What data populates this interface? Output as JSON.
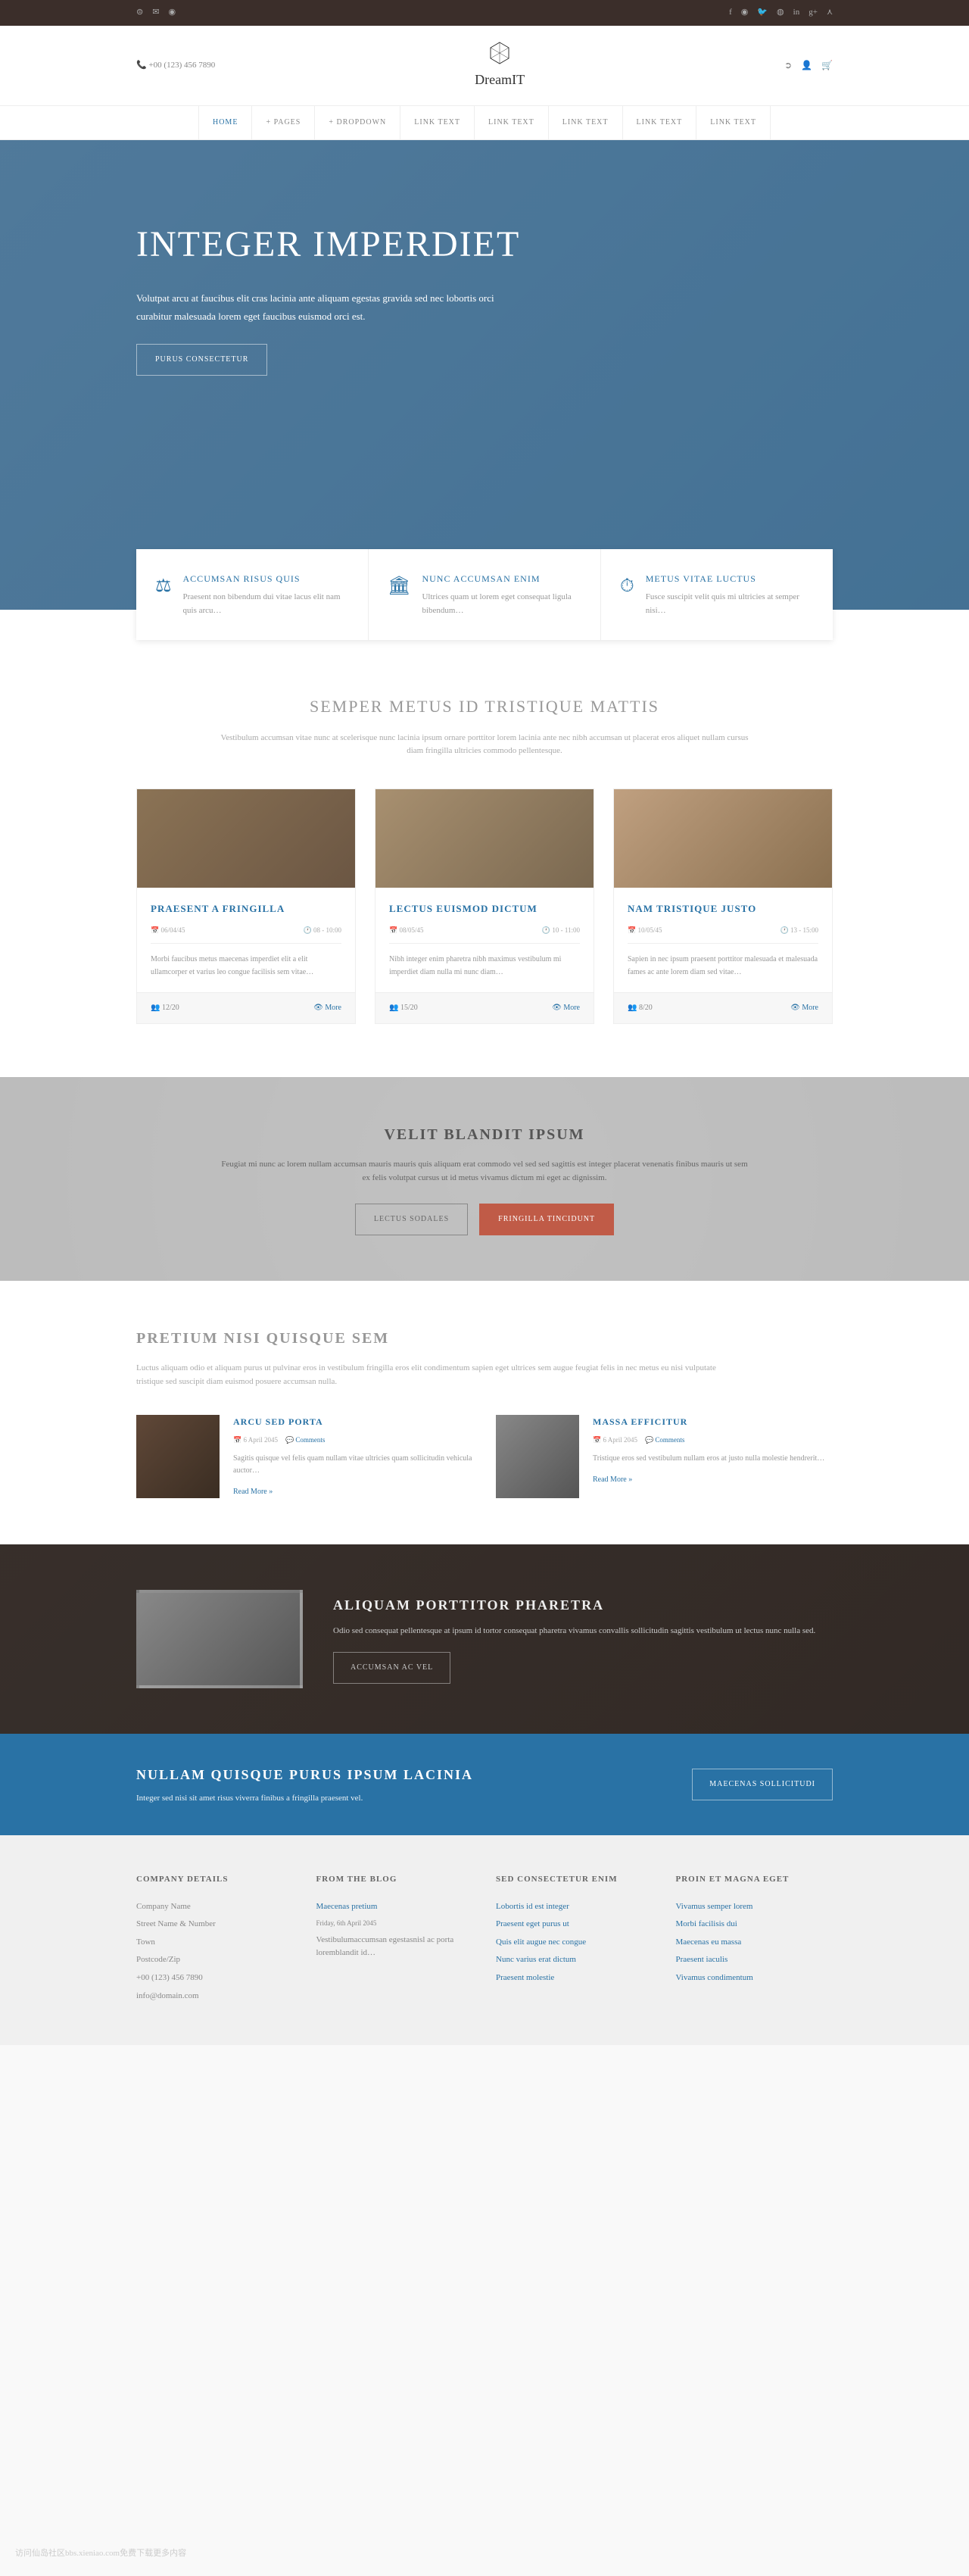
{
  "topbar": {
    "left_icons": [
      "skype",
      "mail",
      "globe"
    ],
    "right_icons": [
      "facebook",
      "pinterest",
      "twitter",
      "dribbble",
      "linkedin",
      "google-plus",
      "rss"
    ]
  },
  "header": {
    "phone": "+00 (123) 456 7890",
    "logo": "DreamIT",
    "icons": [
      "login",
      "user",
      "cart"
    ]
  },
  "nav": [
    {
      "label": "HOME",
      "active": true
    },
    {
      "label": "+ PAGES"
    },
    {
      "label": "+ DROPDOWN"
    },
    {
      "label": "LINK TEXT"
    },
    {
      "label": "LINK TEXT"
    },
    {
      "label": "LINK TEXT"
    },
    {
      "label": "LINK TEXT"
    },
    {
      "label": "LINK TEXT"
    }
  ],
  "hero": {
    "title": "INTEGER IMPERDIET",
    "text": "Volutpat arcu at faucibus elit cras lacinia ante aliquam egestas gravida sed nec lobortis orci curabitur malesuada lorem eget faucibus euismod orci est.",
    "button": "PURUS CONSECTETUR"
  },
  "intro": [
    {
      "icon": "gavel",
      "title": "ACCUMSAN RISUS QUIS",
      "text": "Praesent non bibendum dui vitae lacus elit nam quis arcu…"
    },
    {
      "icon": "columns",
      "title": "NUNC ACCUMSAN ENIM",
      "text": "Ultrices quam ut lorem eget consequat ligula bibendum…"
    },
    {
      "icon": "clock",
      "title": "METUS VITAE LUCTUS",
      "text": "Fusce suscipit velit quis mi ultricies at semper nisi…"
    }
  ],
  "section1": {
    "title": "SEMPER METUS ID TRISTIQUE MATTIS",
    "sub": "Vestibulum accumsan vitae nunc at scelerisque nunc lacinia ipsum ornare porttitor lorem lacinia ante nec nibh accumsan ut placerat eros aliquet nullam cursus diam fringilla ultricies commodo pellentesque."
  },
  "cards": [
    {
      "title": "PRAESENT A FRINGILLA",
      "date": "06/04/45",
      "time": "08 - 10:00",
      "text": "Morbi faucibus metus maecenas imperdiet elit a elit ullamcorper et varius leo congue facilisis sem vitae…",
      "count": "12/20",
      "more": "More"
    },
    {
      "title": "LECTUS EUISMOD DICTUM",
      "date": "08/05/45",
      "time": "10 - 11:00",
      "text": "Nibh integer enim pharetra nibh maximus vestibulum mi imperdiet diam nulla mi nunc diam…",
      "count": "15/20",
      "more": "More"
    },
    {
      "title": "NAM TRISTIQUE JUSTO",
      "date": "10/05/45",
      "time": "13 - 15:00",
      "text": "Sapien in nec ipsum praesent porttitor malesuada et malesuada fames ac ante lorem diam sed vitae…",
      "count": "8/20",
      "more": "More"
    }
  ],
  "cta": {
    "title": "VELIT BLANDIT IPSUM",
    "text": "Feugiat mi nunc ac lorem nullam accumsan mauris mauris quis aliquam erat commodo vel sed sed sagittis est integer placerat venenatis finibus mauris ut sem ex felis volutpat cursus ut id metus vivamus dictum mi eget ac dignissim.",
    "btn1": "LECTUS SODALES",
    "btn2": "FRINGILLA TINCIDUNT"
  },
  "blog": {
    "title": "PRETIUM NISI QUISQUE SEM",
    "sub": "Luctus aliquam odio et aliquam purus ut pulvinar eros in vestibulum fringilla eros elit condimentum sapien eget ultrices sem augue feugiat felis in nec metus eu nisi vulputate tristique sed suscipit diam euismod posuere accumsan nulla.",
    "posts": [
      {
        "title": "ARCU SED PORTA",
        "date": "6 April 2045",
        "comments": "Comments",
        "text": "Sagitis quisque vel felis quam nullam vitae ultricies quam sollicitudin vehicula auctor…",
        "more": "Read More »"
      },
      {
        "title": "MASSA EFFICITUR",
        "date": "6 April 2045",
        "comments": "Comments",
        "text": "Tristique eros sed vestibulum nullam eros at justo nulla molestie hendrerit…",
        "more": "Read More »"
      }
    ]
  },
  "dark": {
    "title": "ALIQUAM PORTTITOR PHARETRA",
    "text": "Odio sed consequat pellentesque at ipsum id tortor consequat pharetra vivamus convallis sollicitudin sagittis vestibulum ut lectus nunc nulla sed.",
    "button": "ACCUMSAN AC VEL"
  },
  "blue": {
    "title": "NULLAM QUISQUE PURUS IPSUM LACINIA",
    "text": "Integer sed nisi sit amet risus viverra finibus a fringilla praesent vel.",
    "button": "MAECENAS SOLLICITUDI"
  },
  "footer": {
    "col1": {
      "title": "COMPANY DETAILS",
      "lines": [
        "Company Name",
        "Street Name & Number",
        "Town",
        "Postcode/Zip",
        "+00 (123) 456 7890",
        "info@domain.com"
      ]
    },
    "col2": {
      "title": "FROM THE BLOG",
      "post_title": "Maecenas pretium",
      "date": "Friday, 6th April 2045",
      "text": "Vestibulumaccumsan egestasnisl ac porta loremblandit id…"
    },
    "col3": {
      "title": "SED CONSECTETUR ENIM",
      "links": [
        "Lobortis id est integer",
        "Praesent eget purus ut",
        "Quis elit augue nec congue",
        "Nunc varius erat dictum",
        "Praesent molestie"
      ]
    },
    "col4": {
      "title": "PROIN ET MAGNA EGET",
      "links": [
        "Vivamus semper lorem",
        "Morbi facilisis dui",
        "Maecenas eu massa",
        "Praesent iaculis",
        "Vivamus condimentum"
      ]
    }
  },
  "watermark": "访问仙岛社区bbs.xieniao.com免费下载更多内容"
}
